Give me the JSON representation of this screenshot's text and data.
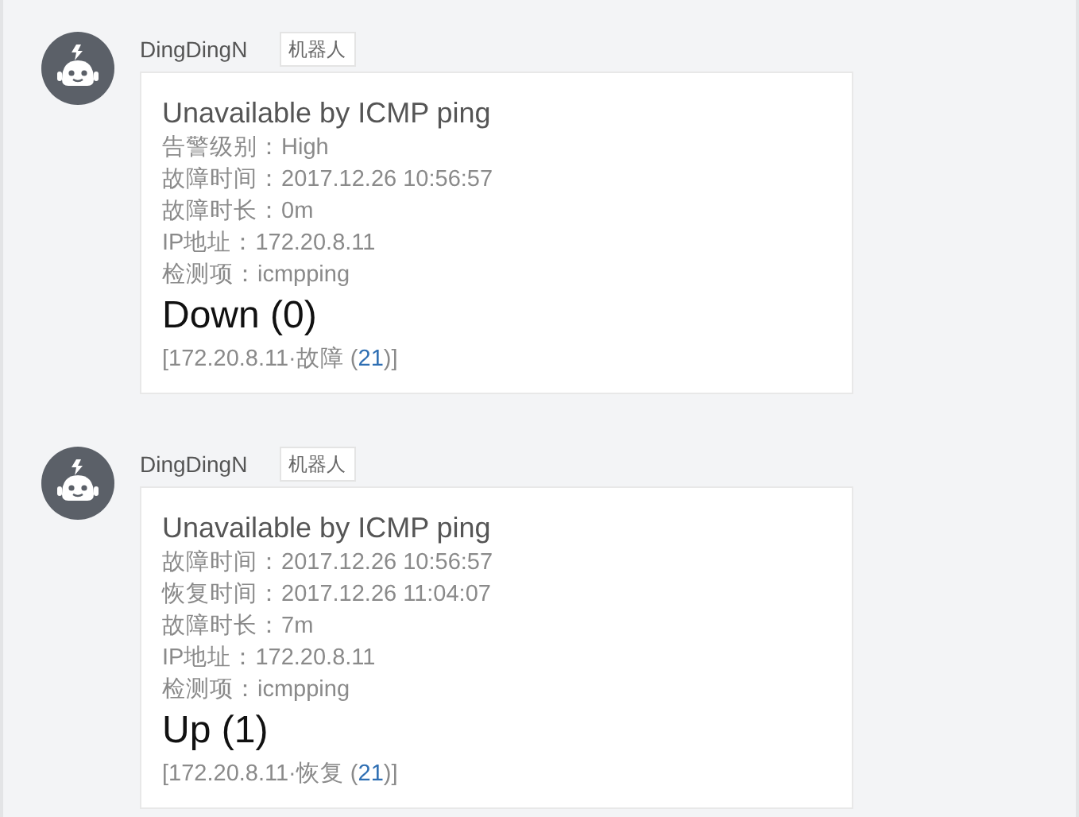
{
  "messages": [
    {
      "sender": "DingDingN",
      "tag": "机器人",
      "title": "Unavailable by ICMP ping",
      "lines": [
        "告警级别：High",
        "故障时间：2017.12.26 10:56:57",
        "故障时长：0m",
        "IP地址：172.20.8.11",
        "检测项：icmpping"
      ],
      "status": "Down (0)",
      "footer": {
        "before": "[172.20.8.11·故障 (",
        "link": "21",
        "after": ")]"
      }
    },
    {
      "sender": "DingDingN",
      "tag": "机器人",
      "title": "Unavailable by ICMP ping",
      "lines": [
        "故障时间：2017.12.26 10:56:57",
        "恢复时间：2017.12.26 11:04:07",
        "故障时长：7m",
        "IP地址：172.20.8.11",
        "检测项：icmpping"
      ],
      "status": "Up (1)",
      "footer": {
        "before": "[172.20.8.11·恢复 (",
        "link": "21",
        "after": ")]"
      }
    }
  ]
}
